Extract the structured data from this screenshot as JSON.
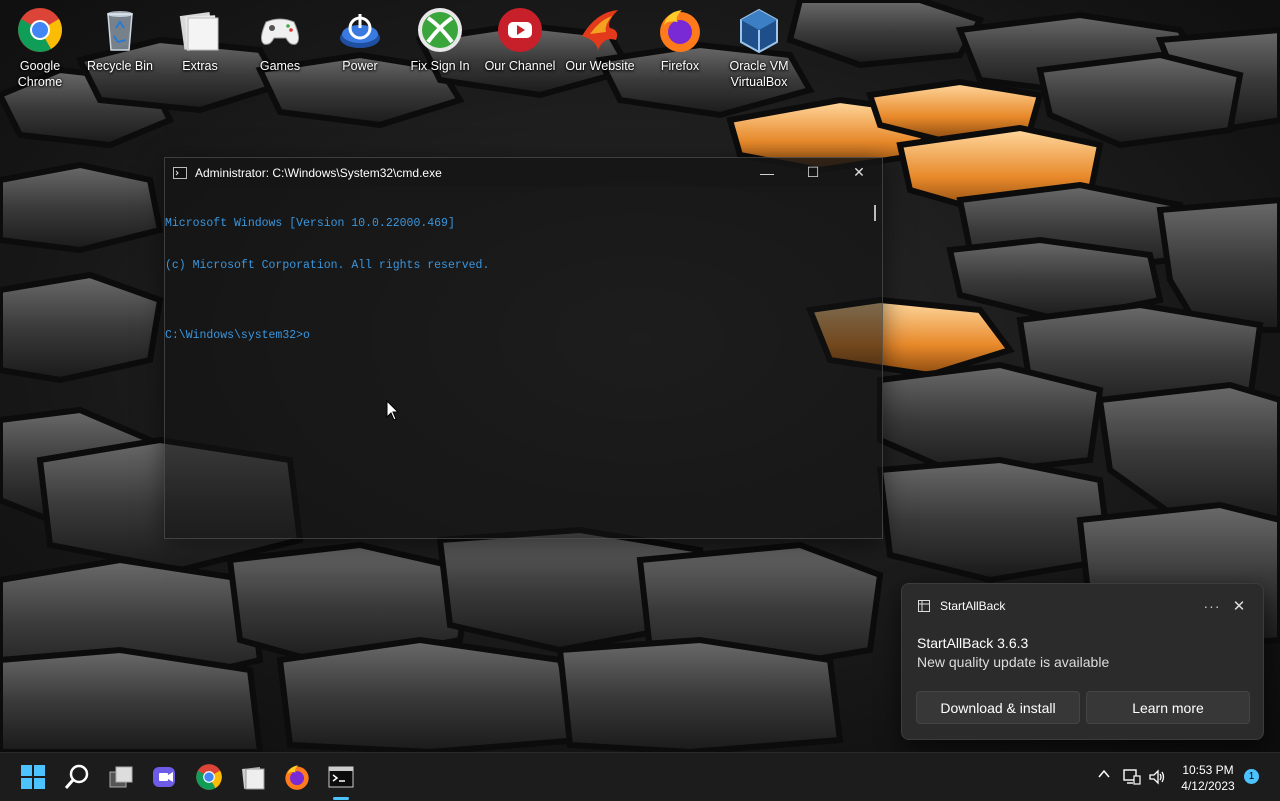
{
  "desktop": {
    "icons": [
      {
        "label_line1": "Google",
        "label_line2": "Chrome",
        "icon": "chrome-icon"
      },
      {
        "label_line1": "Recycle Bin",
        "label_line2": "",
        "icon": "recycle-bin-icon"
      },
      {
        "label_line1": "Extras",
        "label_line2": "",
        "icon": "folder-icon"
      },
      {
        "label_line1": "Games",
        "label_line2": "",
        "icon": "gamepad-icon"
      },
      {
        "label_line1": "Power",
        "label_line2": "",
        "icon": "power-icon"
      },
      {
        "label_line1": "Fix Sign In",
        "label_line2": "",
        "icon": "xbox-icon"
      },
      {
        "label_line1": "Our Channel",
        "label_line2": "",
        "icon": "youtube-icon"
      },
      {
        "label_line1": "Our Website",
        "label_line2": "",
        "icon": "phoenix-icon"
      },
      {
        "label_line1": "Firefox",
        "label_line2": "",
        "icon": "firefox-icon"
      },
      {
        "label_line1": "Oracle VM",
        "label_line2": "VirtualBox",
        "icon": "virtualbox-icon"
      }
    ]
  },
  "cmd_window": {
    "title": "Administrator: C:\\Windows\\System32\\cmd.exe",
    "minimize_glyph": "—",
    "maximize_glyph": "☐",
    "close_glyph": "✕",
    "lines": [
      "Microsoft Windows [Version 10.0.22000.469]",
      "(c) Microsoft Corporation. All rights reserved.",
      "",
      "C:\\Windows\\system32>o"
    ]
  },
  "notification": {
    "app_name": "StartAllBack",
    "more_glyph": "···",
    "close_glyph": "✕",
    "title": "StartAllBack 3.6.3",
    "message": "New quality update is available",
    "primary_button": "Download & install",
    "secondary_button": "Learn more"
  },
  "taskbar": {
    "clock_time": "10:53 PM",
    "clock_date": "4/12/2023",
    "notification_count": "1"
  },
  "colors": {
    "console_text": "#3a96dd",
    "accent": "#4cc2ff",
    "wallpaper_orange": "#e8892a"
  }
}
